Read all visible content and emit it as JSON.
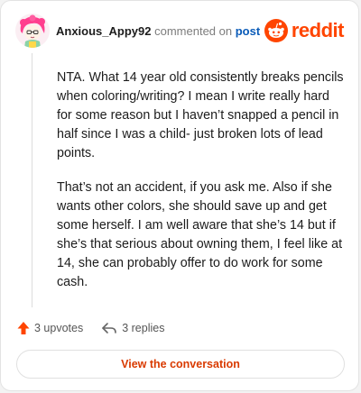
{
  "header": {
    "username": "Anxious_Appy92",
    "action_text": "commented on",
    "post_link": "post",
    "brand_name": "reddit"
  },
  "comment": {
    "paragraphs": [
      "NTA. What 14 year old consistently breaks pencils when coloring/writing? I mean I write really hard for some reason but I haven’t snapped a pencil in half since I was a child- just broken lots of lead points.",
      "That’s not an accident, if you ask me. Also if she wants other colors, she should save up and get some herself. I am well aware that she’s 14 but if she’s that serious about owning them, I feel like at 14, she can probably offer to do work for some cash."
    ]
  },
  "actions": {
    "upvotes": "3 upvotes",
    "replies": "3 replies"
  },
  "cta": {
    "label": "View the conversation"
  },
  "colors": {
    "brand": "#ff4500",
    "upvote": "#ff4500",
    "link": "#0a5bb8",
    "cta_text": "#d93a00"
  },
  "icons": {
    "avatar": "pink-haired-avatar",
    "logo": "reddit-snoo-icon",
    "upvote": "upvote-arrow-icon",
    "reply": "reply-arrow-icon"
  }
}
